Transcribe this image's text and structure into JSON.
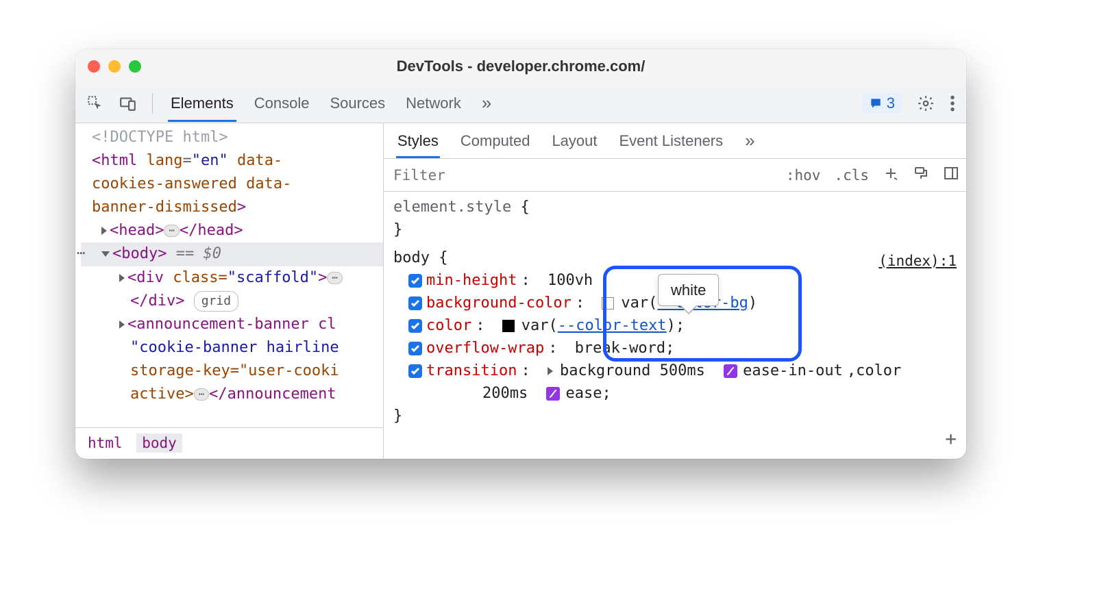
{
  "window": {
    "title": "DevTools - developer.chrome.com/"
  },
  "toolbar": {
    "tabs": [
      "Elements",
      "Console",
      "Sources",
      "Network"
    ],
    "active_tab": "Elements",
    "overflow": "»",
    "message_count": "3"
  },
  "dom": {
    "doctype": "<!DOCTYPE html>",
    "html_open": {
      "tag": "html",
      "attrs_text": "lang=\"en\" data-cookies-answered data-banner-dismissed"
    },
    "head_label": "head",
    "body_label": "body",
    "selected_suffix": "== $0",
    "scaffold": {
      "tag": "div",
      "class_attr": "class=",
      "class_val": "\"scaffold\"",
      "grid_badge": "grid"
    },
    "announcement1": "<announcement-banner cl",
    "announcement2": "\"cookie-banner hairline",
    "announcement3": "storage-key=\"user-cooki",
    "announcement4_pre": "active>",
    "announcement4_post": "</announcement"
  },
  "breadcrumbs": [
    "html",
    "body"
  ],
  "subtabs": {
    "items": [
      "Styles",
      "Computed",
      "Layout",
      "Event Listeners"
    ],
    "active": "Styles",
    "overflow": "»"
  },
  "filterbar": {
    "placeholder": "Filter",
    "hov": ":hov",
    "cls": ".cls"
  },
  "styles": {
    "element_style": {
      "selector": "element.style",
      "brace_open": "{",
      "brace_close": "}"
    },
    "body_rule": {
      "selector": "body",
      "brace_open": "{",
      "brace_close": "}",
      "source": "(index):1",
      "props": {
        "min_height": {
          "name": "min-height",
          "value": "100vh"
        },
        "background_color": {
          "name": "background-color",
          "var_prefix": "var(",
          "var_name": "--color-bg",
          "var_suffix": ")"
        },
        "color": {
          "name": "color",
          "var_prefix": "var(",
          "var_name": "--color-text",
          "var_suffix": ");"
        },
        "overflow_wrap": {
          "name": "overflow-wrap",
          "value": "break-word;"
        },
        "transition": {
          "name": "transition",
          "seg1": "background 500ms",
          "curve1": "ease-in-out",
          "seg1b": ",color",
          "seg2": "200ms",
          "curve2": "ease;"
        }
      }
    }
  },
  "tooltip": {
    "text": "white"
  }
}
